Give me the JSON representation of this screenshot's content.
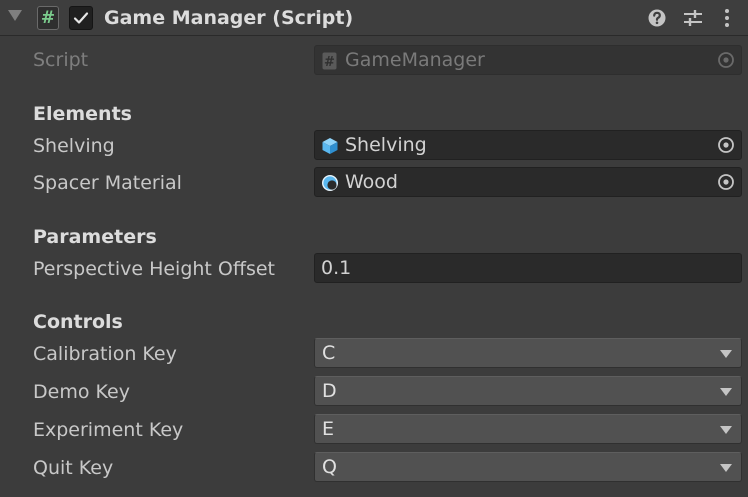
{
  "header": {
    "title": "Game Manager (Script)",
    "enabled": true
  },
  "script_row": {
    "label": "Script",
    "value": "GameManager"
  },
  "sections": {
    "elements": {
      "title": "Elements",
      "shelving_label": "Shelving",
      "shelving_value": "Shelving",
      "spacer_label": "Spacer Material",
      "spacer_value": "Wood"
    },
    "parameters": {
      "title": "Parameters",
      "height_offset_label": "Perspective Height Offset",
      "height_offset_value": "0.1"
    },
    "controls": {
      "title": "Controls",
      "calibration_label": "Calibration Key",
      "calibration_value": "C",
      "demo_label": "Demo Key",
      "demo_value": "D",
      "experiment_label": "Experiment Key",
      "experiment_value": "E",
      "quit_label": "Quit Key",
      "quit_value": "Q"
    }
  },
  "icons": {
    "foldout": "foldout-arrow-icon",
    "script": "csharp-script-icon",
    "checkbox": "checkmark-icon",
    "help": "help-icon",
    "presets": "presets-sliders-icon",
    "menu": "kebab-menu-icon",
    "prefab": "prefab-cube-icon",
    "material": "material-sphere-icon",
    "picker": "object-picker-icon"
  },
  "colors": {
    "background": "#3c3c3c",
    "field": "#2a2a2a",
    "dropdown": "#515151",
    "prefab_blue": "#5ab8f0",
    "script_green": "#7acb8c"
  }
}
